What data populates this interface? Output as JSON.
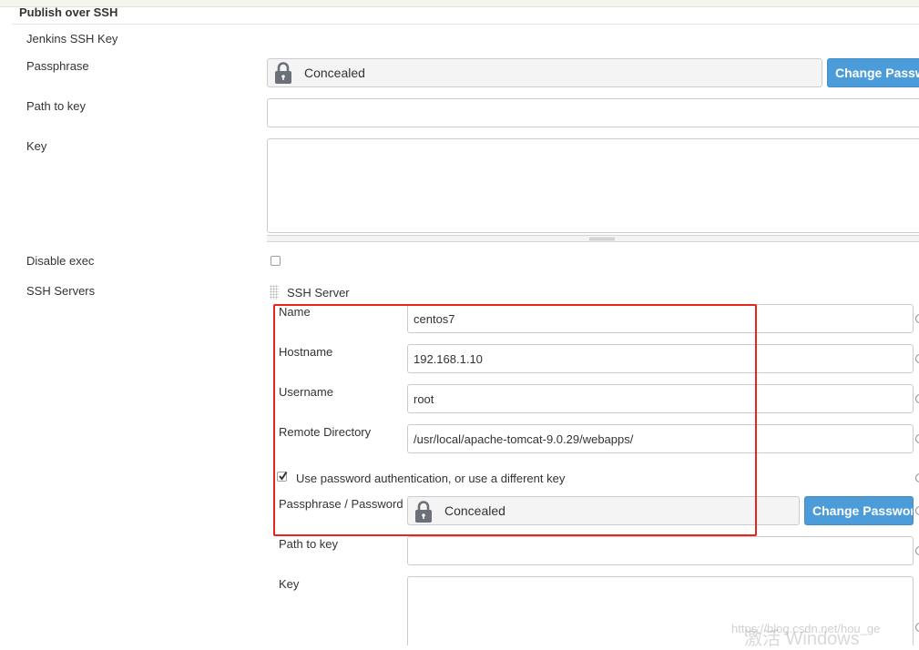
{
  "section": {
    "title": "Publish over SSH"
  },
  "global": {
    "jenkins_ssh_key_label": "Jenkins SSH Key",
    "passphrase_label": "Passphrase",
    "passphrase_value": "Concealed",
    "change_password_button": "Change Password",
    "path_to_key_label": "Path to key",
    "path_to_key_value": "",
    "key_label": "Key",
    "key_value": "",
    "disable_exec_label": "Disable exec",
    "disable_exec_checked": false,
    "ssh_servers_label": "SSH Servers"
  },
  "ssh_server": {
    "header": "SSH Server",
    "name_label": "Name",
    "name_value": "centos7",
    "hostname_label": "Hostname",
    "hostname_value": "192.168.1.10",
    "username_label": "Username",
    "username_value": "root",
    "remote_directory_label": "Remote Directory",
    "remote_directory_value": "/usr/local/apache-tomcat-9.0.29/webapps/",
    "use_password_auth_label": "Use password authentication, or use a different key",
    "use_password_auth_checked": true,
    "passphrase_password_label": "Passphrase / Password",
    "passphrase_password_value": "Concealed",
    "change_password_button": "Change Password",
    "path_to_key_label": "Path to key",
    "path_to_key_value": "",
    "key_label": "Key",
    "key_value": ""
  },
  "overlay": {
    "watermark": "https://blog.csdn.net/hou_ge",
    "activate_windows": "激活 Windows"
  },
  "icons": {
    "lock": "lock-icon",
    "help": "help-icon",
    "drag": "drag-handle-icon",
    "check": "checkmark-icon"
  },
  "colors": {
    "button_blue": "#4b9cd8",
    "highlight_red": "#e8261f",
    "lock_gray": "#6b7079"
  }
}
